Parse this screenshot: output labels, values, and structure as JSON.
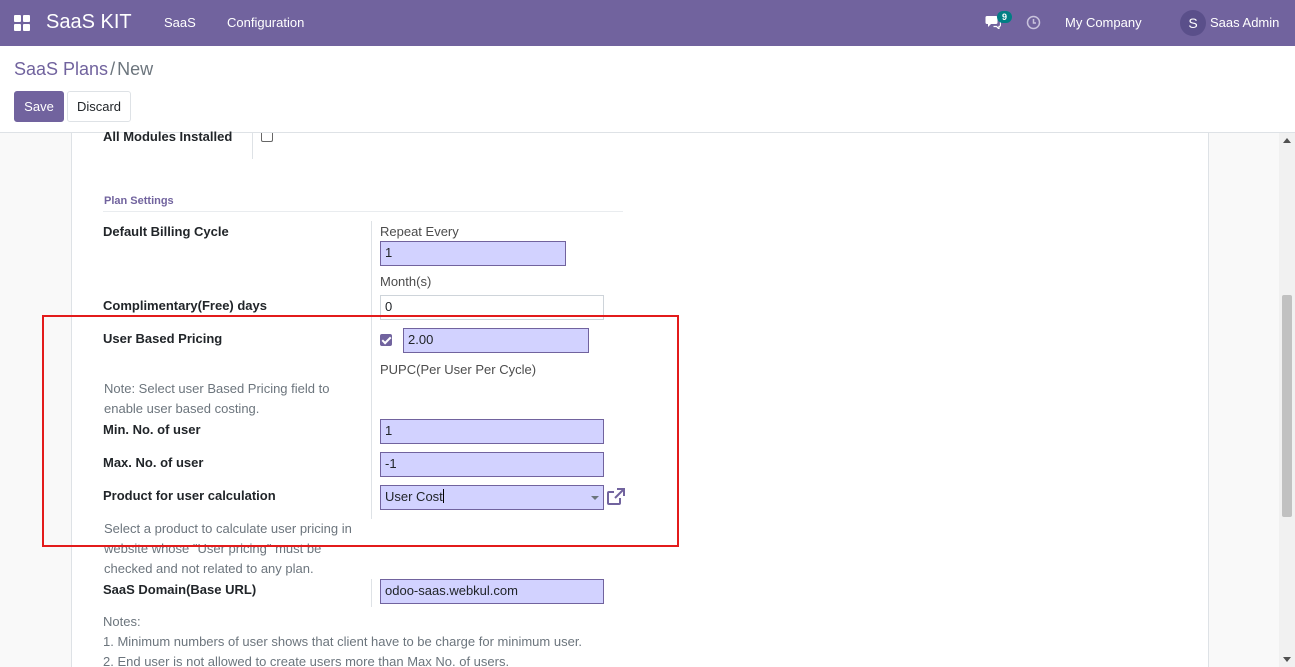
{
  "navbar": {
    "brand": "SaaS KIT",
    "menu": [
      "SaaS",
      "Configuration"
    ],
    "chat_badge": "9",
    "company": "My Company",
    "avatar_letter": "S",
    "user": "Saas Admin"
  },
  "breadcrumb": {
    "parent": "SaaS Plans",
    "separator": "/",
    "current": "New"
  },
  "buttons": {
    "save": "Save",
    "discard": "Discard"
  },
  "form": {
    "all_modules_label": "All Modules Installed",
    "section_title": "Plan Settings",
    "billing_cycle_label": "Default Billing Cycle",
    "repeat_every_label": "Repeat Every",
    "repeat_every_value": "1",
    "months_label": "Month(s)",
    "free_days_label": "Complimentary(Free) days",
    "free_days_value": "0",
    "user_pricing_label": "User Based Pricing",
    "user_pricing_checked": true,
    "user_pricing_value": "2.00",
    "pupc_label": "PUPC(Per User Per Cycle)",
    "user_pricing_note_1": "Note: Select user Based Pricing field to",
    "user_pricing_note_2": "enable user based costing.",
    "min_users_label": "Min. No. of user",
    "min_users_value": "1",
    "max_users_label": "Max. No. of user",
    "max_users_value": "-1",
    "product_label": "Product for user calculation",
    "product_value": "User Cost",
    "product_note_1": "Select a product to calculate user pricing in",
    "product_note_2": "website whose \"User pricing\" must be",
    "product_note_3": "checked and not related to any plan.",
    "domain_label": "SaaS Domain(Base URL)",
    "domain_value": "odoo-saas.webkul.com",
    "notes_title": "Notes:",
    "note_1": "1. Minimum numbers of user shows that client have to be charge for minimum user.",
    "note_2": "2. End user is not allowed to create users more than Max No. of users."
  },
  "colors": {
    "brand": "#71639e",
    "highlight": "#e31b1b",
    "input_bg": "#d2d2ff"
  },
  "icons": [
    "apps-grid-icon",
    "chat-icon",
    "clock-icon",
    "external-link-icon",
    "caret-down-icon"
  ]
}
